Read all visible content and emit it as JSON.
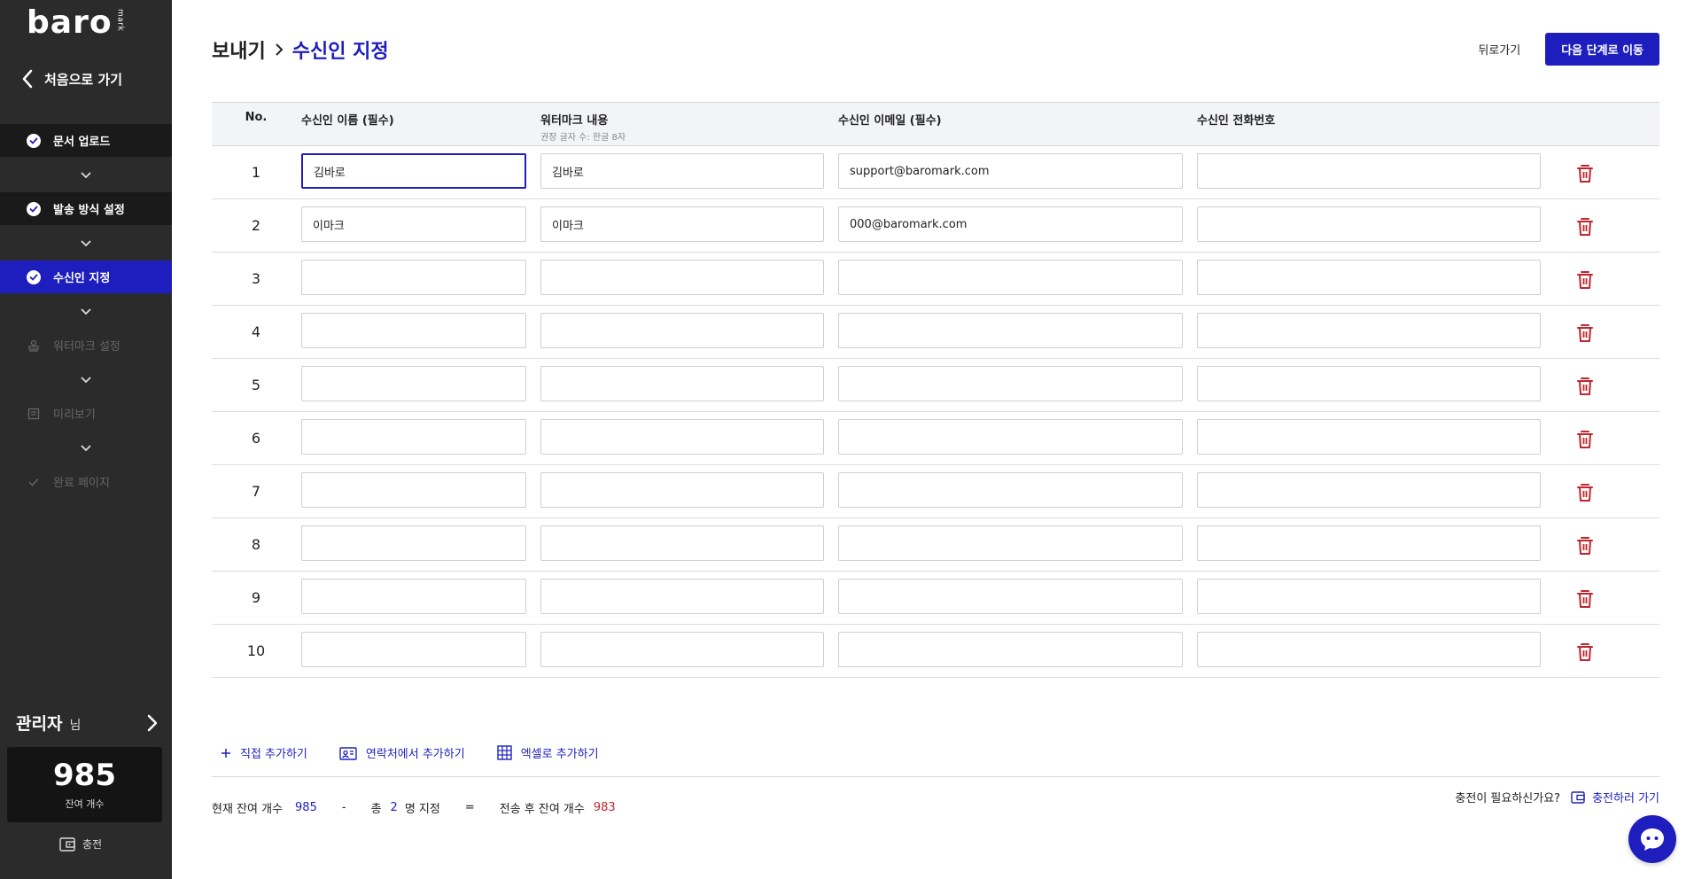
{
  "sidebar": {
    "logo": "baro",
    "logo_sub": "mark",
    "back_home": "처음으로 가기",
    "steps": [
      {
        "label": "문서 업로드",
        "state": "done"
      },
      {
        "label": "발송 방식 설정",
        "state": "done"
      },
      {
        "label": "수신인 지정",
        "state": "active"
      },
      {
        "label": "워터마크 설정",
        "state": "disabled"
      },
      {
        "label": "미리보기",
        "state": "disabled"
      },
      {
        "label": "완료 페이지",
        "state": "disabled"
      }
    ],
    "admin_name": "관리자",
    "admin_suffix": "님",
    "balance": "985",
    "balance_label": "잔여 개수",
    "charge": "충전"
  },
  "header": {
    "breadcrumb_root": "보내기",
    "breadcrumb_current": "수신인 지정",
    "back_button": "뒤로가기",
    "next_button": "다음 단계로 이동"
  },
  "table": {
    "columns": {
      "no": "No.",
      "name": "수신인 이름 (필수)",
      "watermark": "워터마크 내용",
      "watermark_hint": "권장 글자 수: 한글 8자",
      "email": "수신인 이메일 (필수)",
      "phone": "수신인 전화번호"
    },
    "rows": [
      {
        "no": "1",
        "name": "김바로",
        "watermark": "김바로",
        "email": "support@baromark.com",
        "phone": ""
      },
      {
        "no": "2",
        "name": "이마크",
        "watermark": "이마크",
        "email": "000@baromark.com",
        "phone": ""
      },
      {
        "no": "3",
        "name": "",
        "watermark": "",
        "email": "",
        "phone": ""
      },
      {
        "no": "4",
        "name": "",
        "watermark": "",
        "email": "",
        "phone": ""
      },
      {
        "no": "5",
        "name": "",
        "watermark": "",
        "email": "",
        "phone": ""
      },
      {
        "no": "6",
        "name": "",
        "watermark": "",
        "email": "",
        "phone": ""
      },
      {
        "no": "7",
        "name": "",
        "watermark": "",
        "email": "",
        "phone": ""
      },
      {
        "no": "8",
        "name": "",
        "watermark": "",
        "email": "",
        "phone": ""
      },
      {
        "no": "9",
        "name": "",
        "watermark": "",
        "email": "",
        "phone": ""
      },
      {
        "no": "10",
        "name": "",
        "watermark": "",
        "email": "",
        "phone": ""
      }
    ]
  },
  "add_actions": {
    "direct": "직접 추가하기",
    "contacts": "연락처에서 추가하기",
    "excel": "엑셀로 추가하기"
  },
  "summary": {
    "current_label": "현재 잔여 개수",
    "current_value": "985",
    "minus": "-",
    "total_prefix": "총",
    "total_value": "2",
    "total_suffix": "명 지정",
    "equals": "=",
    "after_label": "전송 후 잔여 개수",
    "after_value": "983"
  },
  "charge_prompt": {
    "question": "충전이 필요하신가요?",
    "link": "충전하러 가기"
  },
  "colors": {
    "accent": "#1e1ebf",
    "sidebar": "#2b2b2b",
    "danger": "#c0262d"
  }
}
